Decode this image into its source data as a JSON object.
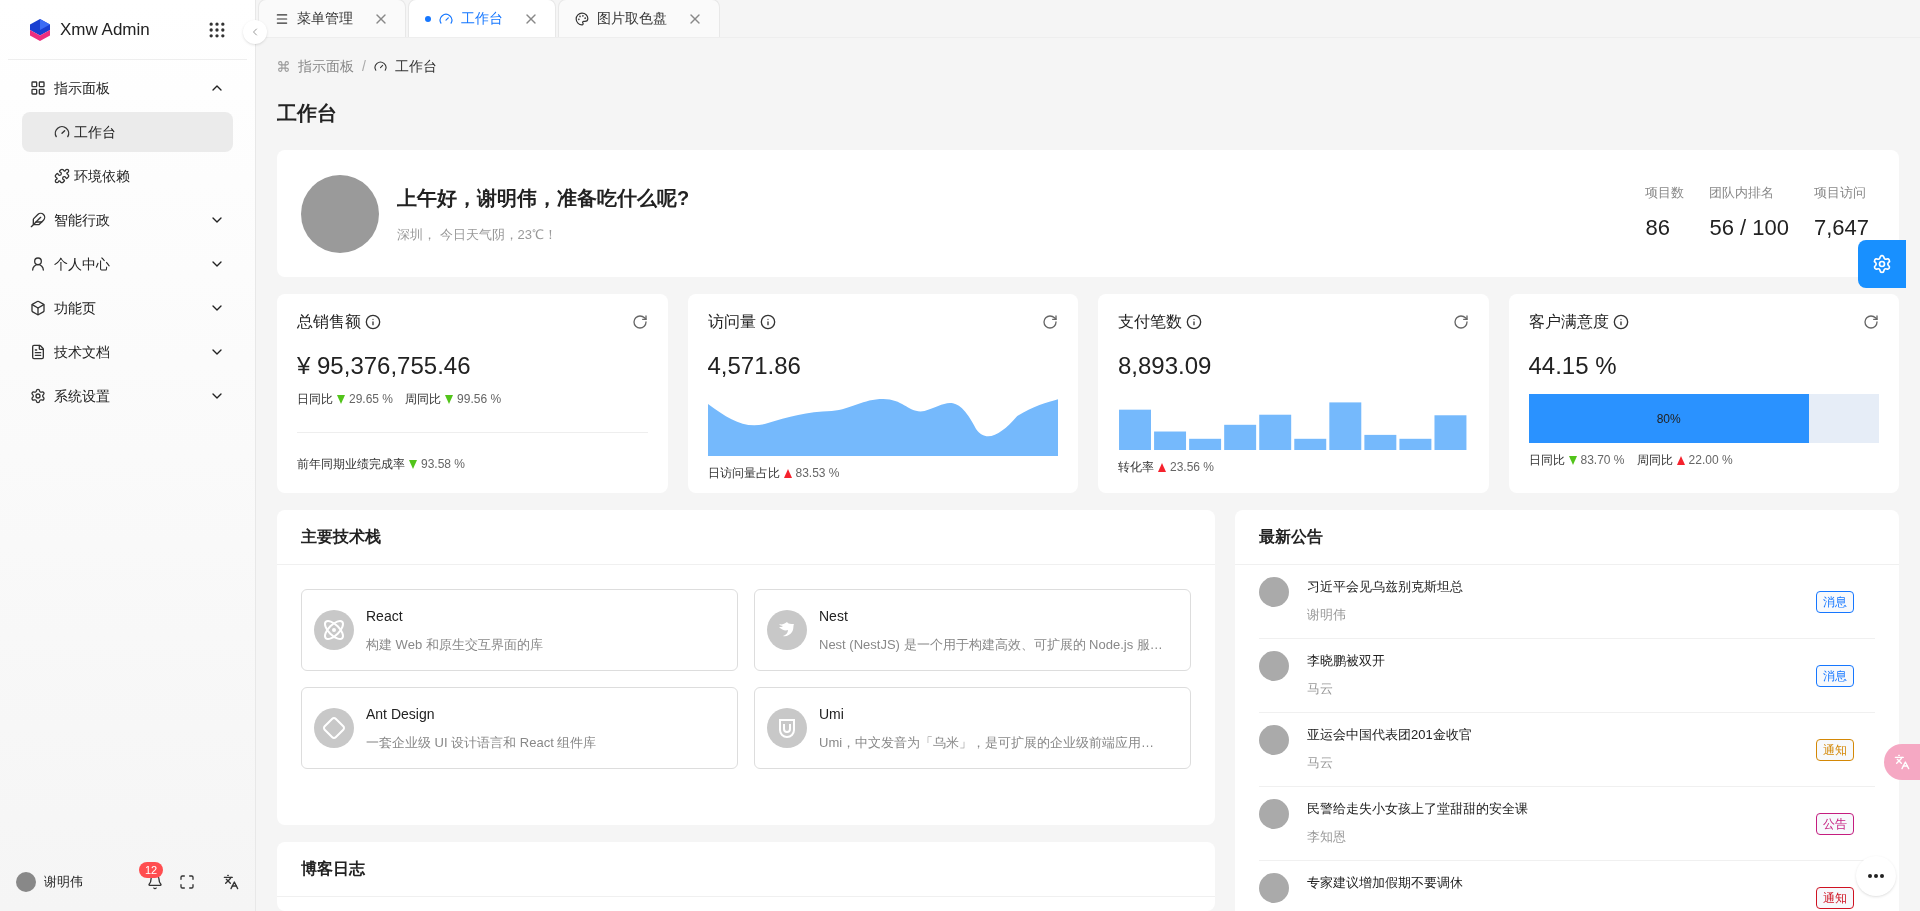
{
  "app": {
    "title": "Xmw Admin"
  },
  "sidebar": {
    "items": [
      {
        "label": "指示面板",
        "selected": false,
        "expanded": true,
        "children": [
          {
            "label": "工作台",
            "selected": true
          },
          {
            "label": "环境依赖",
            "selected": false
          }
        ]
      },
      {
        "label": "智能行政",
        "selected": false,
        "expanded": false
      },
      {
        "label": "个人中心",
        "selected": false,
        "expanded": false
      },
      {
        "label": "功能页",
        "selected": false,
        "expanded": false
      },
      {
        "label": "技术文档",
        "selected": false,
        "expanded": false
      },
      {
        "label": "系统设置",
        "selected": false,
        "expanded": false
      }
    ],
    "user": "谢明伟",
    "notification_count": "12"
  },
  "tabs": [
    {
      "label": "菜单管理",
      "selected": false
    },
    {
      "label": "工作台",
      "selected": true
    },
    {
      "label": "图片取色盘",
      "selected": false
    }
  ],
  "breadcrumb": [
    "指示面板",
    "工作台"
  ],
  "breadcrumb_separator": "/",
  "page_title": "工作台",
  "welcome": {
    "greeting": "上午好，谢明伟，准备吃什么呢?",
    "subtitle": "深圳， 今日天气阴，23℃！",
    "stats": [
      {
        "label": "项目数",
        "value": "86"
      },
      {
        "label": "团队内排名",
        "value": "56 / 100"
      },
      {
        "label": "项目访问",
        "value": "7,647"
      }
    ]
  },
  "stat_cards": [
    {
      "kind": "compare",
      "title": "总销售额",
      "value": "¥ 95,376,755.46",
      "trends": [
        {
          "label": "日同比",
          "kind": "down",
          "value": "29.65 %"
        },
        {
          "label": "周同比",
          "kind": "down",
          "value": "99.56 %"
        }
      ],
      "footer": [
        {
          "label": "前年同期业绩完成率",
          "kind": "down",
          "value": "93.58 %"
        }
      ]
    },
    {
      "kind": "area",
      "title": "访问量",
      "value": "4,571.86",
      "footer": [
        {
          "label": "日访问量占比",
          "kind": "up",
          "value": "83.53 %"
        }
      ]
    },
    {
      "kind": "bar",
      "title": "支付笔数",
      "value": "8,893.09",
      "footer": [
        {
          "label": "转化率",
          "kind": "up",
          "value": "23.56 %"
        }
      ]
    },
    {
      "kind": "progress",
      "title": "客户满意度",
      "value": "44.15 %",
      "level": 0.8,
      "progress_label": "80%",
      "footer": [
        {
          "label": "日同比",
          "kind": "down",
          "value": "83.70 %"
        },
        {
          "label": "周同比",
          "kind": "up",
          "value": "22.00 %"
        }
      ]
    }
  ],
  "tech_stack": {
    "title": "主要技术栈",
    "items": [
      {
        "name": "React",
        "description": "构建 Web 和原生交互界面的库"
      },
      {
        "name": "Nest",
        "description": "Nest (NestJS) 是一个用于构建高效、可扩展的 Node.js 服…"
      },
      {
        "name": "Ant Design",
        "description": "一套企业级 UI 设计语言和 React 组件库"
      },
      {
        "name": "Umi",
        "description": "Umi，中文发音为「乌米」，是可扩展的企业级前端应用…"
      }
    ]
  },
  "blog": {
    "title": "博客日志"
  },
  "announcements": {
    "title": "最新公告",
    "items": [
      {
        "title": "习近平会见乌兹别克斯坦总",
        "author": "谢明伟",
        "tag": "消息",
        "color": "#1677ff"
      },
      {
        "title": "李晓鹏被双开",
        "author": "马云",
        "tag": "消息",
        "color": "#1677ff"
      },
      {
        "title": "亚运会中国代表团201金收官",
        "author": "马云",
        "tag": "通知",
        "color": "#d48806"
      },
      {
        "title": "民警给走失小女孩上了堂甜甜的安全课",
        "author": "李知恩",
        "tag": "公告",
        "color": "#c41d7f"
      },
      {
        "title": "专家建议增加假期不要调休",
        "tag": "通知",
        "color": "#cf1322"
      }
    ]
  }
}
